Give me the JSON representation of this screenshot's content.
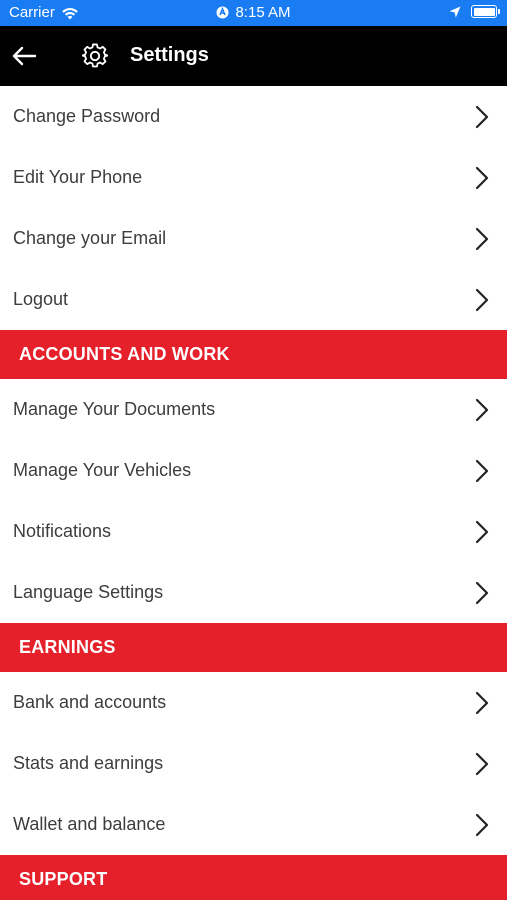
{
  "status_bar": {
    "carrier": "Carrier",
    "time": "8:15 AM",
    "icons": [
      "wifi-icon",
      "alarm-icon",
      "location-icon",
      "battery-icon"
    ],
    "color": "#1a7cf2"
  },
  "nav": {
    "title": "Settings",
    "back_icon": "back-arrow-icon",
    "title_icon": "gear-icon"
  },
  "groups": {
    "account": {
      "items": [
        "Change Password",
        "Edit Your Phone",
        "Change your Email",
        "Logout"
      ]
    },
    "accounts_and_work": {
      "header": "ACCOUNTS AND WORK",
      "items": [
        "Manage Your Documents",
        "Manage Your Vehicles",
        "Notifications",
        "Language Settings"
      ]
    },
    "earnings": {
      "header": "EARNINGS",
      "items": [
        "Bank and accounts",
        "Stats and earnings",
        "Wallet and balance"
      ]
    },
    "support": {
      "header": "SUPPORT"
    }
  },
  "colors": {
    "section_header": "#e5202a",
    "nav_background": "#000000"
  }
}
